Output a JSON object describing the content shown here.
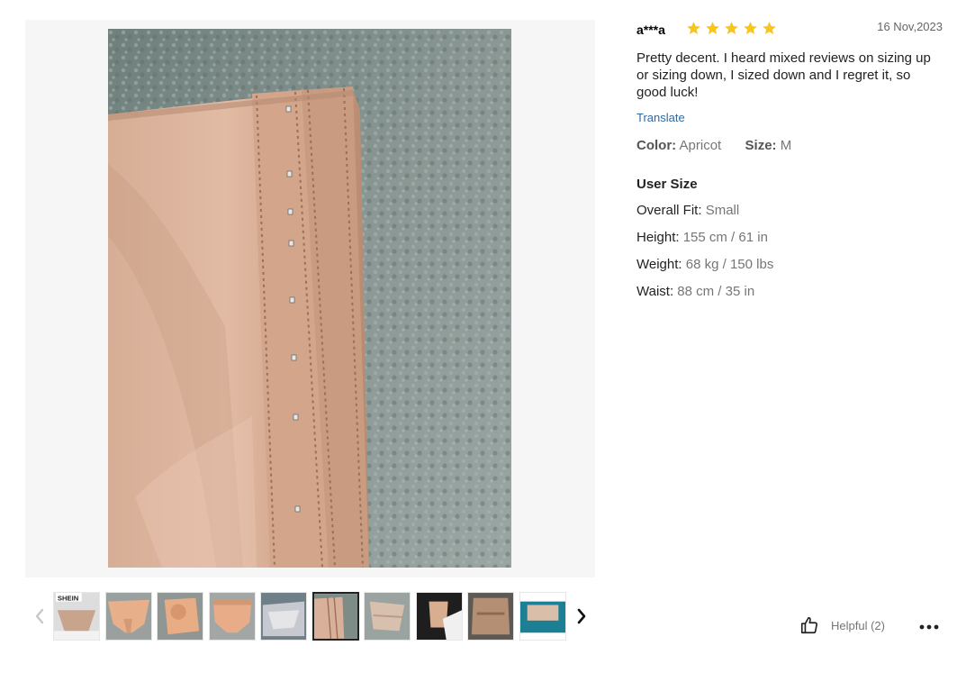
{
  "gallery": {
    "main_image": "product-photo-beige-shapewear-hook-closure",
    "thumbnail_count": 10,
    "active_thumbnail": 6
  },
  "review": {
    "reviewer": "a***a",
    "rating": 5,
    "date": "16 Nov,2023",
    "text": "Pretty decent. I heard mixed reviews on sizing up or sizing down, I sized down and I regret it, so good luck!",
    "translate_label": "Translate",
    "color_label": "Color:",
    "color_value": "Apricot",
    "size_label": "Size:",
    "size_value": "M",
    "user_size_title": "User Size",
    "user_size": {
      "overall_fit_label": "Overall Fit:",
      "overall_fit_value": "Small",
      "height_label": "Height:",
      "height_value": "155 cm / 61 in",
      "weight_label": "Weight:",
      "weight_value": "68 kg / 150 lbs",
      "waist_label": "Waist:",
      "waist_value": "88 cm / 35 in"
    }
  },
  "actions": {
    "helpful_label": "Helpful (2)",
    "more_icon": "more-dots-icon"
  },
  "colors": {
    "star": "#f8c51c",
    "link": "#2d68a8",
    "muted": "#767676",
    "panel_bg": "#f6f6f6"
  }
}
